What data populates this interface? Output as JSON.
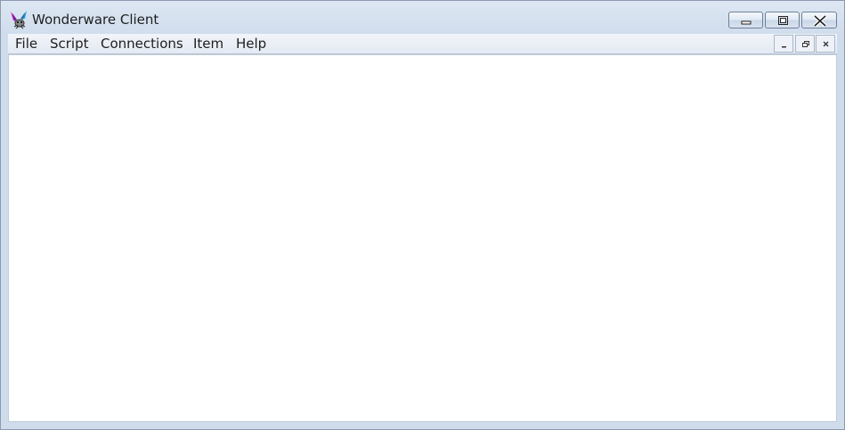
{
  "window": {
    "title": "Wonderware Client",
    "icon": "wonderware-logo-icon"
  },
  "caption_buttons": {
    "minimize_icon": "minimize-icon",
    "maximize_icon": "maximize-icon",
    "close_icon": "close-icon"
  },
  "menu": {
    "items": [
      {
        "label": "File"
      },
      {
        "label": "Script"
      },
      {
        "label": "Connections"
      },
      {
        "label": "Item"
      },
      {
        "label": "Help"
      }
    ]
  },
  "mdi_buttons": {
    "minimize_icon": "mdi-minimize-icon",
    "restore_icon": "mdi-restore-icon",
    "close_icon": "mdi-close-icon"
  },
  "colors": {
    "frame": "#cfdcec",
    "client": "#ffffff"
  }
}
